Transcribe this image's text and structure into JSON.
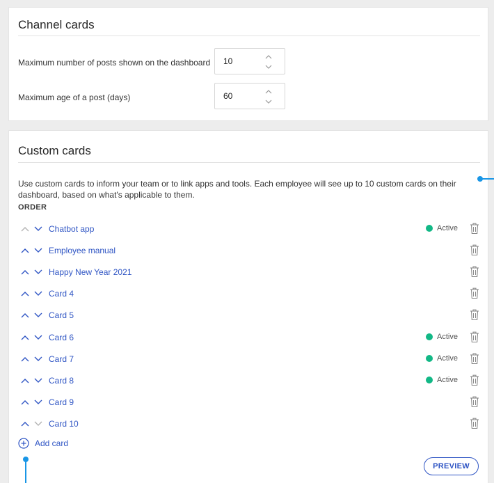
{
  "channel_cards": {
    "title": "Channel cards",
    "settings": [
      {
        "label": "Maximum number of posts shown on the dashboard",
        "value": "10"
      },
      {
        "label": "Maximum age of a post (days)",
        "value": "60"
      }
    ]
  },
  "custom_cards": {
    "title": "Custom cards",
    "description": "Use custom cards to inform your team or to link apps and tools. Each employee will see up to 10 custom cards on their dashboard, based on what's applicable to them.",
    "order_label": "ORDER",
    "items": [
      {
        "name": "Chatbot app",
        "status": "Active"
      },
      {
        "name": "Employee manual",
        "status": ""
      },
      {
        "name": "Happy New Year 2021",
        "status": ""
      },
      {
        "name": "Card 4",
        "status": ""
      },
      {
        "name": "Card 5",
        "status": ""
      },
      {
        "name": "Card 6",
        "status": "Active"
      },
      {
        "name": "Card 7",
        "status": "Active"
      },
      {
        "name": "Card 8",
        "status": "Active"
      },
      {
        "name": "Card 9",
        "status": ""
      },
      {
        "name": "Card 10",
        "status": ""
      }
    ],
    "add_card_label": "Add card",
    "preview_label": "PREVIEW"
  },
  "icons": {
    "move_up": "chevron-up-icon",
    "move_down": "chevron-down-icon",
    "delete": "trash-icon",
    "add": "plus-circle-icon"
  },
  "colors": {
    "link": "#2f55c4",
    "active_status": "#12b886",
    "annotation": "#1996e6"
  }
}
